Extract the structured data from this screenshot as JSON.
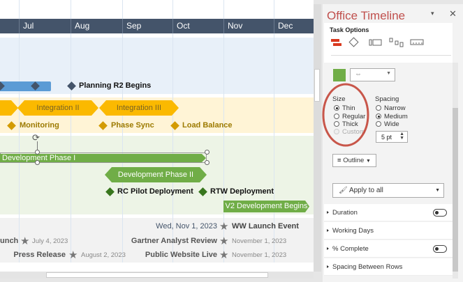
{
  "timeline": {
    "months": [
      "Jul",
      "Aug",
      "Sep",
      "Oct",
      "Nov",
      "Dec"
    ],
    "blue_lane": {
      "milestone": "Planning R2 Begins"
    },
    "yellow_lane": {
      "tasks": [
        "Integration II",
        "Integration III"
      ],
      "milestones": [
        "Monitoring",
        "Phase Sync",
        "Load Balance"
      ]
    },
    "green_lane": {
      "tasks": [
        "Development Phase I",
        "Development Phase II",
        "V2 Development Begins"
      ],
      "milestones": [
        "RC Pilot Deployment",
        "RTW Deployment"
      ]
    },
    "grey_lane": {
      "date_label": "Wed, Nov 1, 2023",
      "events": [
        {
          "label": "WW Launch Event"
        },
        {
          "label": "unch",
          "date": "July 4, 2023"
        },
        {
          "label": "Gartner Analyst Review",
          "date": "November 1, 2023"
        },
        {
          "label": "Press Release",
          "date": "August 2, 2023"
        },
        {
          "label": "Public Website Live",
          "date": "November 1, 2023"
        }
      ]
    },
    "colors": {
      "header": "#44546a",
      "blue": "#5b9bd5",
      "yellow": "#fbb900",
      "green": "#70ad47",
      "dark_green": "#38761d"
    }
  },
  "panel": {
    "title": "Office Timeline",
    "section": "Task Options",
    "tabs": [
      "task-shape-icon",
      "milestone-icon",
      "swimlane-icon",
      "connector-icon",
      "timeband-icon"
    ],
    "swatch_color": "#70ad47",
    "size": {
      "label": "Size",
      "options": [
        "Thin",
        "Regular",
        "Thick",
        "Custom"
      ],
      "selected": "Thin"
    },
    "spacing": {
      "label": "Spacing",
      "options": [
        "Narrow",
        "Medium",
        "Wide"
      ],
      "selected": "Medium",
      "value": "5 pt"
    },
    "outline_label": "Outline",
    "apply_label": "Apply to all",
    "sections": [
      {
        "label": "Duration",
        "toggle": false
      },
      {
        "label": "Working Days"
      },
      {
        "label": "% Complete",
        "toggle": false
      },
      {
        "label": "Spacing Between Rows"
      }
    ]
  }
}
